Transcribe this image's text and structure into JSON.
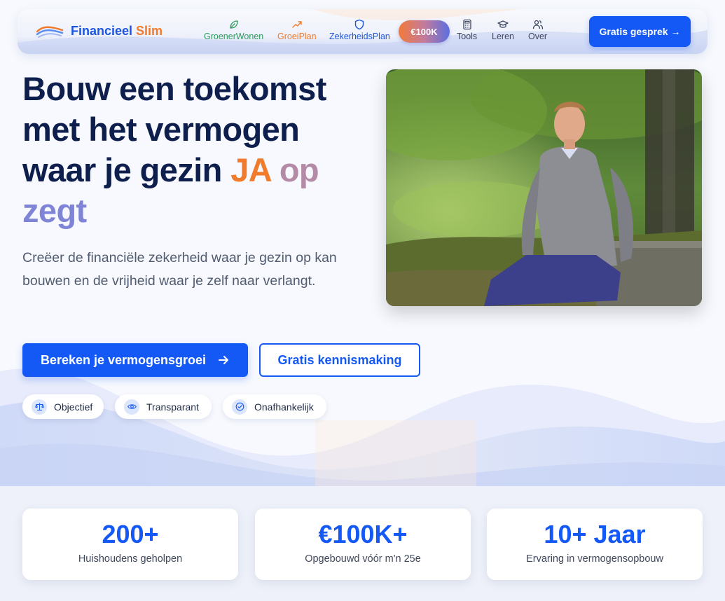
{
  "brand": {
    "name_part1": "Financieel ",
    "name_part2": "Slim"
  },
  "nav": {
    "items": [
      {
        "label": "GroenerWonen",
        "icon": "leaf-icon"
      },
      {
        "label": "GroeiPlan",
        "icon": "trending-up-icon"
      },
      {
        "label": "ZekerheidsPlan",
        "icon": "shield-icon"
      },
      {
        "label": "Tools",
        "icon": "calculator-icon"
      },
      {
        "label": "Leren",
        "icon": "graduation-cap-icon"
      },
      {
        "label": "Over",
        "icon": "users-icon"
      }
    ],
    "pill_label": "€100K",
    "cta_label": "Gratis gesprek →"
  },
  "hero": {
    "title_main": "Bouw een toekomst met het vermogen waar je gezin ",
    "title_ja": "JA",
    "title_op": " op",
    "title_zegt": "zegt",
    "subtitle": "Creëer de financiële zekerheid waar je gezin op kan bouwen en de vrijheid waar je zelf naar verlangt.",
    "primary_button": "Bereken je vermogensgroei",
    "secondary_button": "Gratis kennismaking",
    "badges": [
      {
        "label": "Objectief",
        "icon": "scale-icon"
      },
      {
        "label": "Transparant",
        "icon": "eye-icon"
      },
      {
        "label": "Onafhankelijk",
        "icon": "check-circle-icon"
      }
    ]
  },
  "stats": [
    {
      "value": "200+",
      "label": "Huishoudens geholpen"
    },
    {
      "value": "€100K+",
      "label": "Opgebouwd vóór m'n 25e"
    },
    {
      "value": "10+ Jaar",
      "label": "Ervaring in vermogensopbouw"
    }
  ],
  "colors": {
    "primary": "#1458f5",
    "accent_orange": "#f07b2c",
    "navy": "#0f1f4d",
    "green": "#2e9b5d"
  }
}
